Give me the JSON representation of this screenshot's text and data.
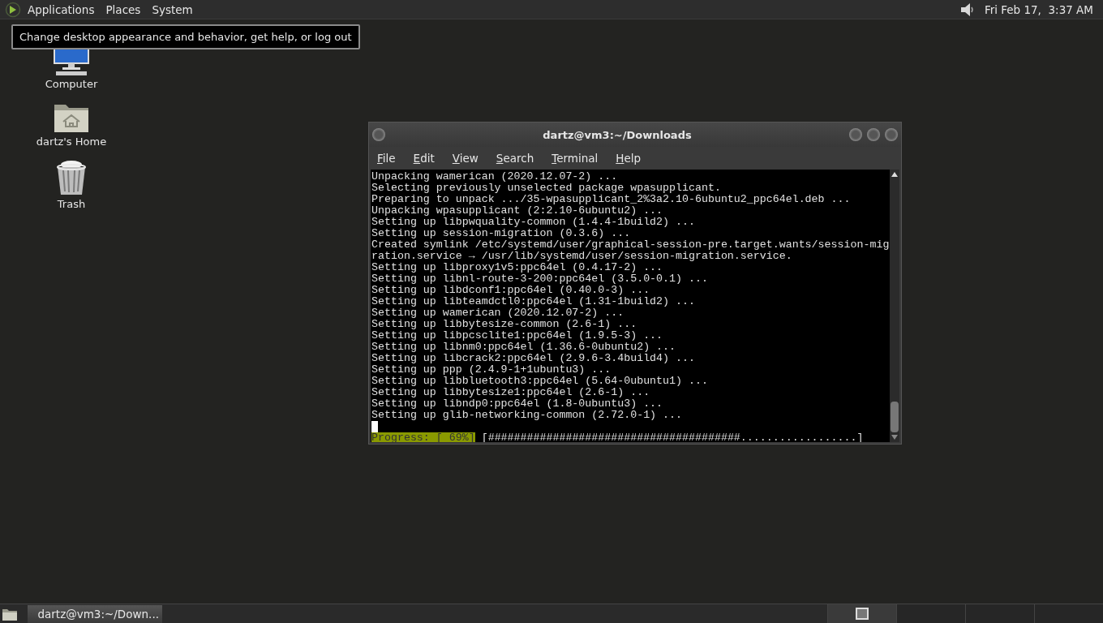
{
  "top_panel": {
    "menus": [
      "Applications",
      "Places",
      "System"
    ],
    "clock": "Fri Feb 17,  3:37 AM"
  },
  "tooltip": "Change desktop appearance and behavior, get help, or log out",
  "desktop_icons": [
    {
      "kind": "computer",
      "label": "Computer"
    },
    {
      "kind": "home",
      "label": "dartz's Home"
    },
    {
      "kind": "trash",
      "label": "Trash"
    }
  ],
  "terminal": {
    "title": "dartz@vm3:~/Downloads",
    "menus": [
      "File",
      "Edit",
      "View",
      "Search",
      "Terminal",
      "Help"
    ],
    "lines": [
      "Unpacking wamerican (2020.12.07-2) ...",
      "Selecting previously unselected package wpasupplicant.",
      "Preparing to unpack .../35-wpasupplicant_2%3a2.10-6ubuntu2_ppc64el.deb ...",
      "Unpacking wpasupplicant (2:2.10-6ubuntu2) ...",
      "Setting up libpwquality-common (1.4.4-1build2) ...",
      "Setting up session-migration (0.3.6) ...",
      "Created symlink /etc/systemd/user/graphical-session-pre.target.wants/session-mig",
      "ration.service → /usr/lib/systemd/user/session-migration.service.",
      "Setting up libproxy1v5:ppc64el (0.4.17-2) ...",
      "Setting up libnl-route-3-200:ppc64el (3.5.0-0.1) ...",
      "Setting up libdconf1:ppc64el (0.40.0-3) ...",
      "Setting up libteamdctl0:ppc64el (1.31-1build2) ...",
      "Setting up wamerican (2020.12.07-2) ...",
      "Setting up libbytesize-common (2.6-1) ...",
      "Setting up libpcsclite1:ppc64el (1.9.5-3) ...",
      "Setting up libnm0:ppc64el (1.36.6-0ubuntu2) ...",
      "Setting up libcrack2:ppc64el (2.9.6-3.4build4) ...",
      "Setting up ppp (2.4.9-1+1ubuntu3) ...",
      "Setting up libbluetooth3:ppc64el (5.64-0ubuntu1) ...",
      "Setting up libbytesize1:ppc64el (2.6-1) ...",
      "Setting up libndp0:ppc64el (1.8-0ubuntu3) ...",
      "Setting up glib-networking-common (2.72.0-1) ..."
    ],
    "progress_label": "Progress: [ 69%]",
    "progress_bar": "[#######################################..................]"
  },
  "taskbar": {
    "tasks": [
      {
        "label": "dartz@vm3:~/Down...",
        "selected": true
      }
    ],
    "workspaces": [
      {
        "selected": true
      },
      {
        "selected": false
      },
      {
        "selected": false
      },
      {
        "selected": false
      }
    ]
  }
}
